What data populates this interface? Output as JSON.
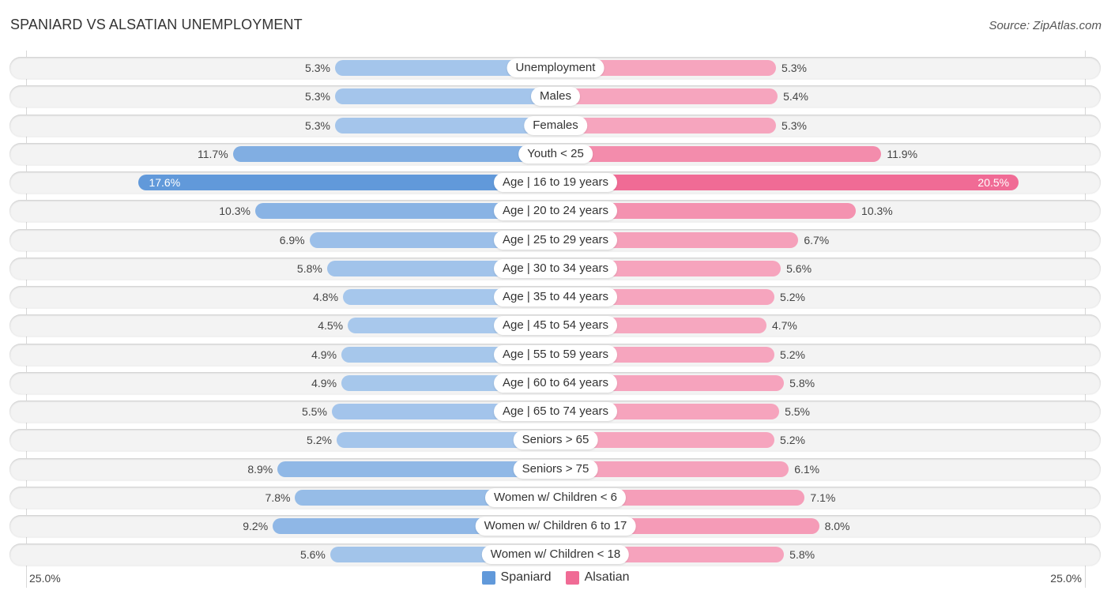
{
  "header": {
    "title": "SPANIARD VS ALSATIAN UNEMPLOYMENT",
    "source": "Source: ZipAtlas.com"
  },
  "colors": {
    "spaniard_strong": "#6199da",
    "spaniard_light": "#a8c8ec",
    "alsatian_strong": "#f06b95",
    "alsatian_light": "#f6a8c0"
  },
  "chart_data": {
    "type": "bar",
    "orientation": "horizontal-diverging",
    "title": "SPANIARD VS ALSATIAN UNEMPLOYMENT",
    "xlabel": "",
    "ylabel": "",
    "xlim": [
      0,
      25.0
    ],
    "axis_labels": {
      "left": "25.0%",
      "right": "25.0%"
    },
    "legend": {
      "position": "bottom-center",
      "entries": [
        "Spaniard",
        "Alsatian"
      ]
    },
    "categories": [
      "Unemployment",
      "Males",
      "Females",
      "Youth < 25",
      "Age | 16 to 19 years",
      "Age | 20 to 24 years",
      "Age | 25 to 29 years",
      "Age | 30 to 34 years",
      "Age | 35 to 44 years",
      "Age | 45 to 54 years",
      "Age | 55 to 59 years",
      "Age | 60 to 64 years",
      "Age | 65 to 74 years",
      "Seniors > 65",
      "Seniors > 75",
      "Women w/ Children < 6",
      "Women w/ Children 6 to 17",
      "Women w/ Children < 18"
    ],
    "series": [
      {
        "name": "Spaniard",
        "side": "left",
        "values": [
          5.3,
          5.3,
          5.3,
          11.7,
          17.6,
          10.3,
          6.9,
          5.8,
          4.8,
          4.5,
          4.9,
          4.9,
          5.5,
          5.2,
          8.9,
          7.8,
          9.2,
          5.6
        ],
        "labels": [
          "5.3%",
          "5.3%",
          "5.3%",
          "11.7%",
          "17.6%",
          "10.3%",
          "6.9%",
          "5.8%",
          "4.8%",
          "4.5%",
          "4.9%",
          "4.9%",
          "5.5%",
          "5.2%",
          "8.9%",
          "7.8%",
          "9.2%",
          "5.6%"
        ]
      },
      {
        "name": "Alsatian",
        "side": "right",
        "values": [
          5.3,
          5.4,
          5.3,
          11.9,
          20.5,
          10.3,
          6.7,
          5.6,
          5.2,
          4.7,
          5.2,
          5.8,
          5.5,
          5.2,
          6.1,
          7.1,
          8.0,
          5.8
        ],
        "labels": [
          "5.3%",
          "5.4%",
          "5.3%",
          "11.9%",
          "20.5%",
          "10.3%",
          "6.7%",
          "5.6%",
          "5.2%",
          "4.7%",
          "5.2%",
          "5.8%",
          "5.5%",
          "5.2%",
          "6.1%",
          "7.1%",
          "8.0%",
          "5.8%"
        ]
      }
    ]
  }
}
